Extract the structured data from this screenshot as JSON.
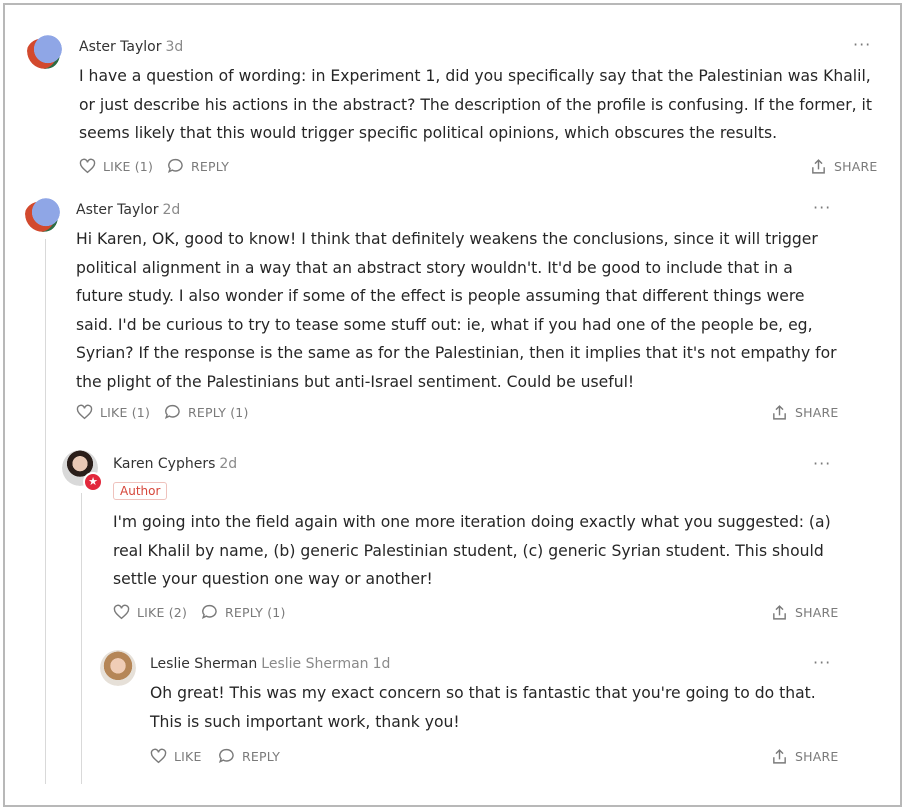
{
  "comments": [
    {
      "author": "Aster Taylor",
      "time": "3d",
      "text": "I have a question of wording: in Experiment 1, did you specifically say that the Palestinian was Khalil, or just describe his actions in the abstract? The description of the profile is confusing. If the former, it seems likely that this would trigger specific political opinions, which obscures the results.",
      "like_label": "LIKE (1)",
      "reply_label": "REPLY",
      "share_label": "SHARE",
      "more_label": "···"
    },
    {
      "author": "Aster Taylor",
      "time": "2d",
      "text": "Hi Karen, OK, good to know! I think that definitely weakens the conclusions, since it will trigger political alignment in a way that an abstract story wouldn't. It'd be good to include that in a future study. I also wonder if some of the effect is people assuming that different things were said. I'd be curious to try to tease some stuff out: ie, what if you had one of the people be, eg, Syrian? If the response is the same as for the Palestinian, then it implies that it's not empathy for the plight of the Palestinians but anti-Israel sentiment. Could be useful!",
      "like_label": "LIKE (1)",
      "reply_label": "REPLY (1)",
      "share_label": "SHARE",
      "more_label": "···"
    },
    {
      "author": "Karen Cyphers",
      "time": "2d",
      "badge": "Author",
      "text": "I'm going into the field again with one more iteration doing exactly what you suggested: (a) real Khalil by name, (b) generic Palestinian student, (c) generic Syrian student. This should settle your question one way or another!",
      "like_label": "LIKE (2)",
      "reply_label": "REPLY (1)",
      "share_label": "SHARE",
      "more_label": "···"
    },
    {
      "author": "Leslie Sherman",
      "alias": "Leslie Sherman",
      "time": "1d",
      "text": "Oh great! This was my exact concern so that is fantastic that you're going to do that. This is such important work, thank you!",
      "like_label": "LIKE",
      "reply_label": "REPLY",
      "share_label": "SHARE",
      "more_label": "···"
    }
  ],
  "colors": {
    "text": "#262626",
    "muted": "#7a7a7a",
    "author_badge": "#d6463a",
    "author_star": "#e2283c",
    "thread_line": "#d9d9d9"
  },
  "icons": [
    "heart-icon",
    "speech-bubble-icon",
    "share-icon",
    "more-icon",
    "star-icon"
  ]
}
